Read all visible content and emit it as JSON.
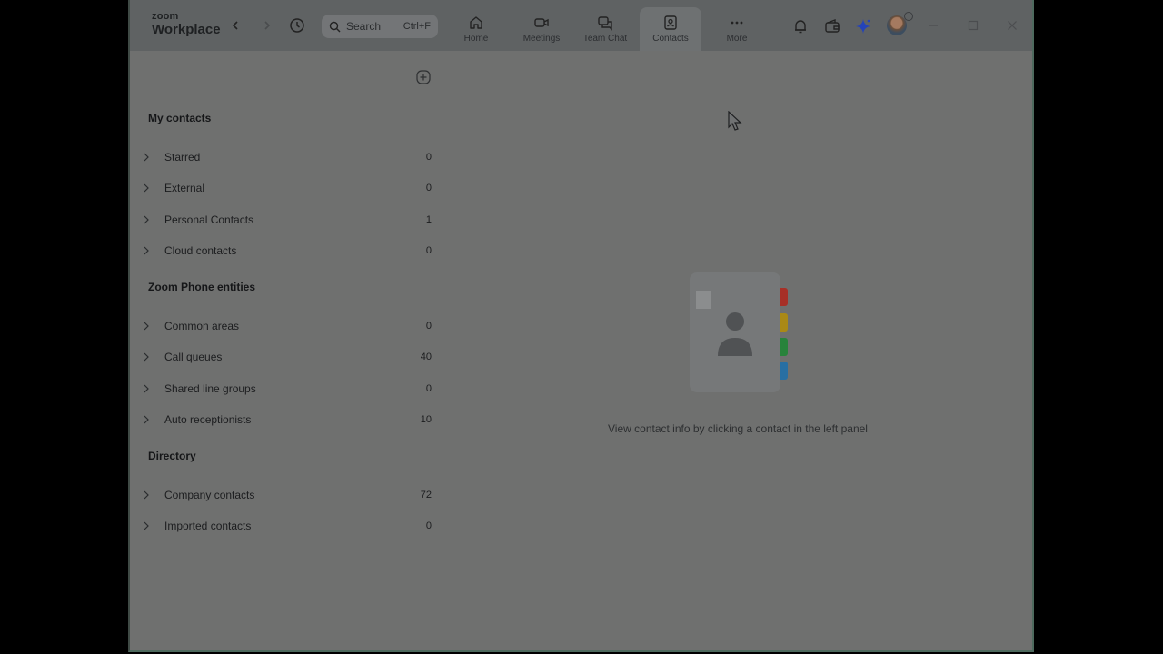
{
  "app": {
    "logo_line1": "zoom",
    "logo_line2": "Workplace"
  },
  "search": {
    "placeholder": "Search",
    "shortcut": "Ctrl+F"
  },
  "tabs": [
    {
      "label": "Home",
      "icon": "home-icon"
    },
    {
      "label": "Meetings",
      "icon": "video-icon"
    },
    {
      "label": "Team Chat",
      "icon": "chat-icon"
    },
    {
      "label": "Contacts",
      "icon": "contacts-icon",
      "active": true
    },
    {
      "label": "More",
      "icon": "more-icon"
    }
  ],
  "contacts": {
    "sections": [
      {
        "title": "My contacts",
        "items": [
          {
            "label": "Starred",
            "count": "0"
          },
          {
            "label": "External",
            "count": "0"
          },
          {
            "label": "Personal Contacts",
            "count": "1"
          },
          {
            "label": "Cloud contacts",
            "count": "0"
          }
        ]
      },
      {
        "title": "Zoom Phone entities",
        "items": [
          {
            "label": "Common areas",
            "count": "0"
          },
          {
            "label": "Call queues",
            "count": "40"
          },
          {
            "label": "Shared line groups",
            "count": "0"
          },
          {
            "label": "Auto receptionists",
            "count": "10"
          }
        ]
      },
      {
        "title": "Directory",
        "items": [
          {
            "label": "Company contacts",
            "count": "72"
          },
          {
            "label": "Imported contacts",
            "count": "0"
          }
        ]
      }
    ]
  },
  "empty_state": {
    "message": "View contact info by clicking a contact in the left panel",
    "tab_colors": [
      "#c5392e",
      "#c8a11a",
      "#2f9a45",
      "#2f82c0"
    ]
  }
}
